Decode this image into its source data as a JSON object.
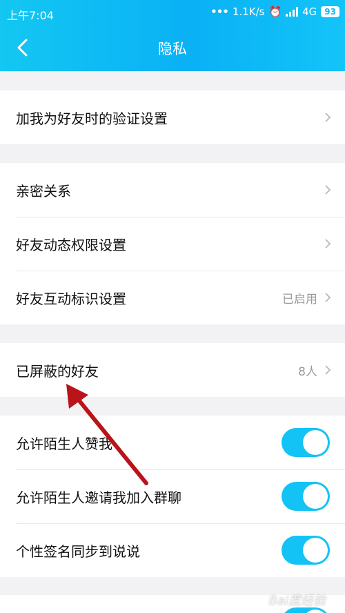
{
  "status_bar": {
    "time": "上午7:04",
    "speed": "1.1K/s",
    "network": "4G",
    "battery": "93"
  },
  "header": {
    "title": "隐私"
  },
  "groups": [
    {
      "rows": [
        {
          "label": "加我为好友时的验证设置"
        }
      ]
    },
    {
      "rows": [
        {
          "label": "亲密关系"
        },
        {
          "label": "好友动态权限设置"
        },
        {
          "label": "好友互动标识设置",
          "value": "已启用"
        }
      ]
    },
    {
      "rows": [
        {
          "label": "已屏蔽的好友",
          "value": "8人"
        }
      ]
    },
    {
      "rows": [
        {
          "label": "允许陌生人赞我",
          "toggle": true
        },
        {
          "label": "允许陌生人邀请我加入群聊",
          "toggle": true
        },
        {
          "label": "个性签名同步到说说",
          "toggle": true
        }
      ]
    }
  ],
  "watermark": "Bai度经验"
}
